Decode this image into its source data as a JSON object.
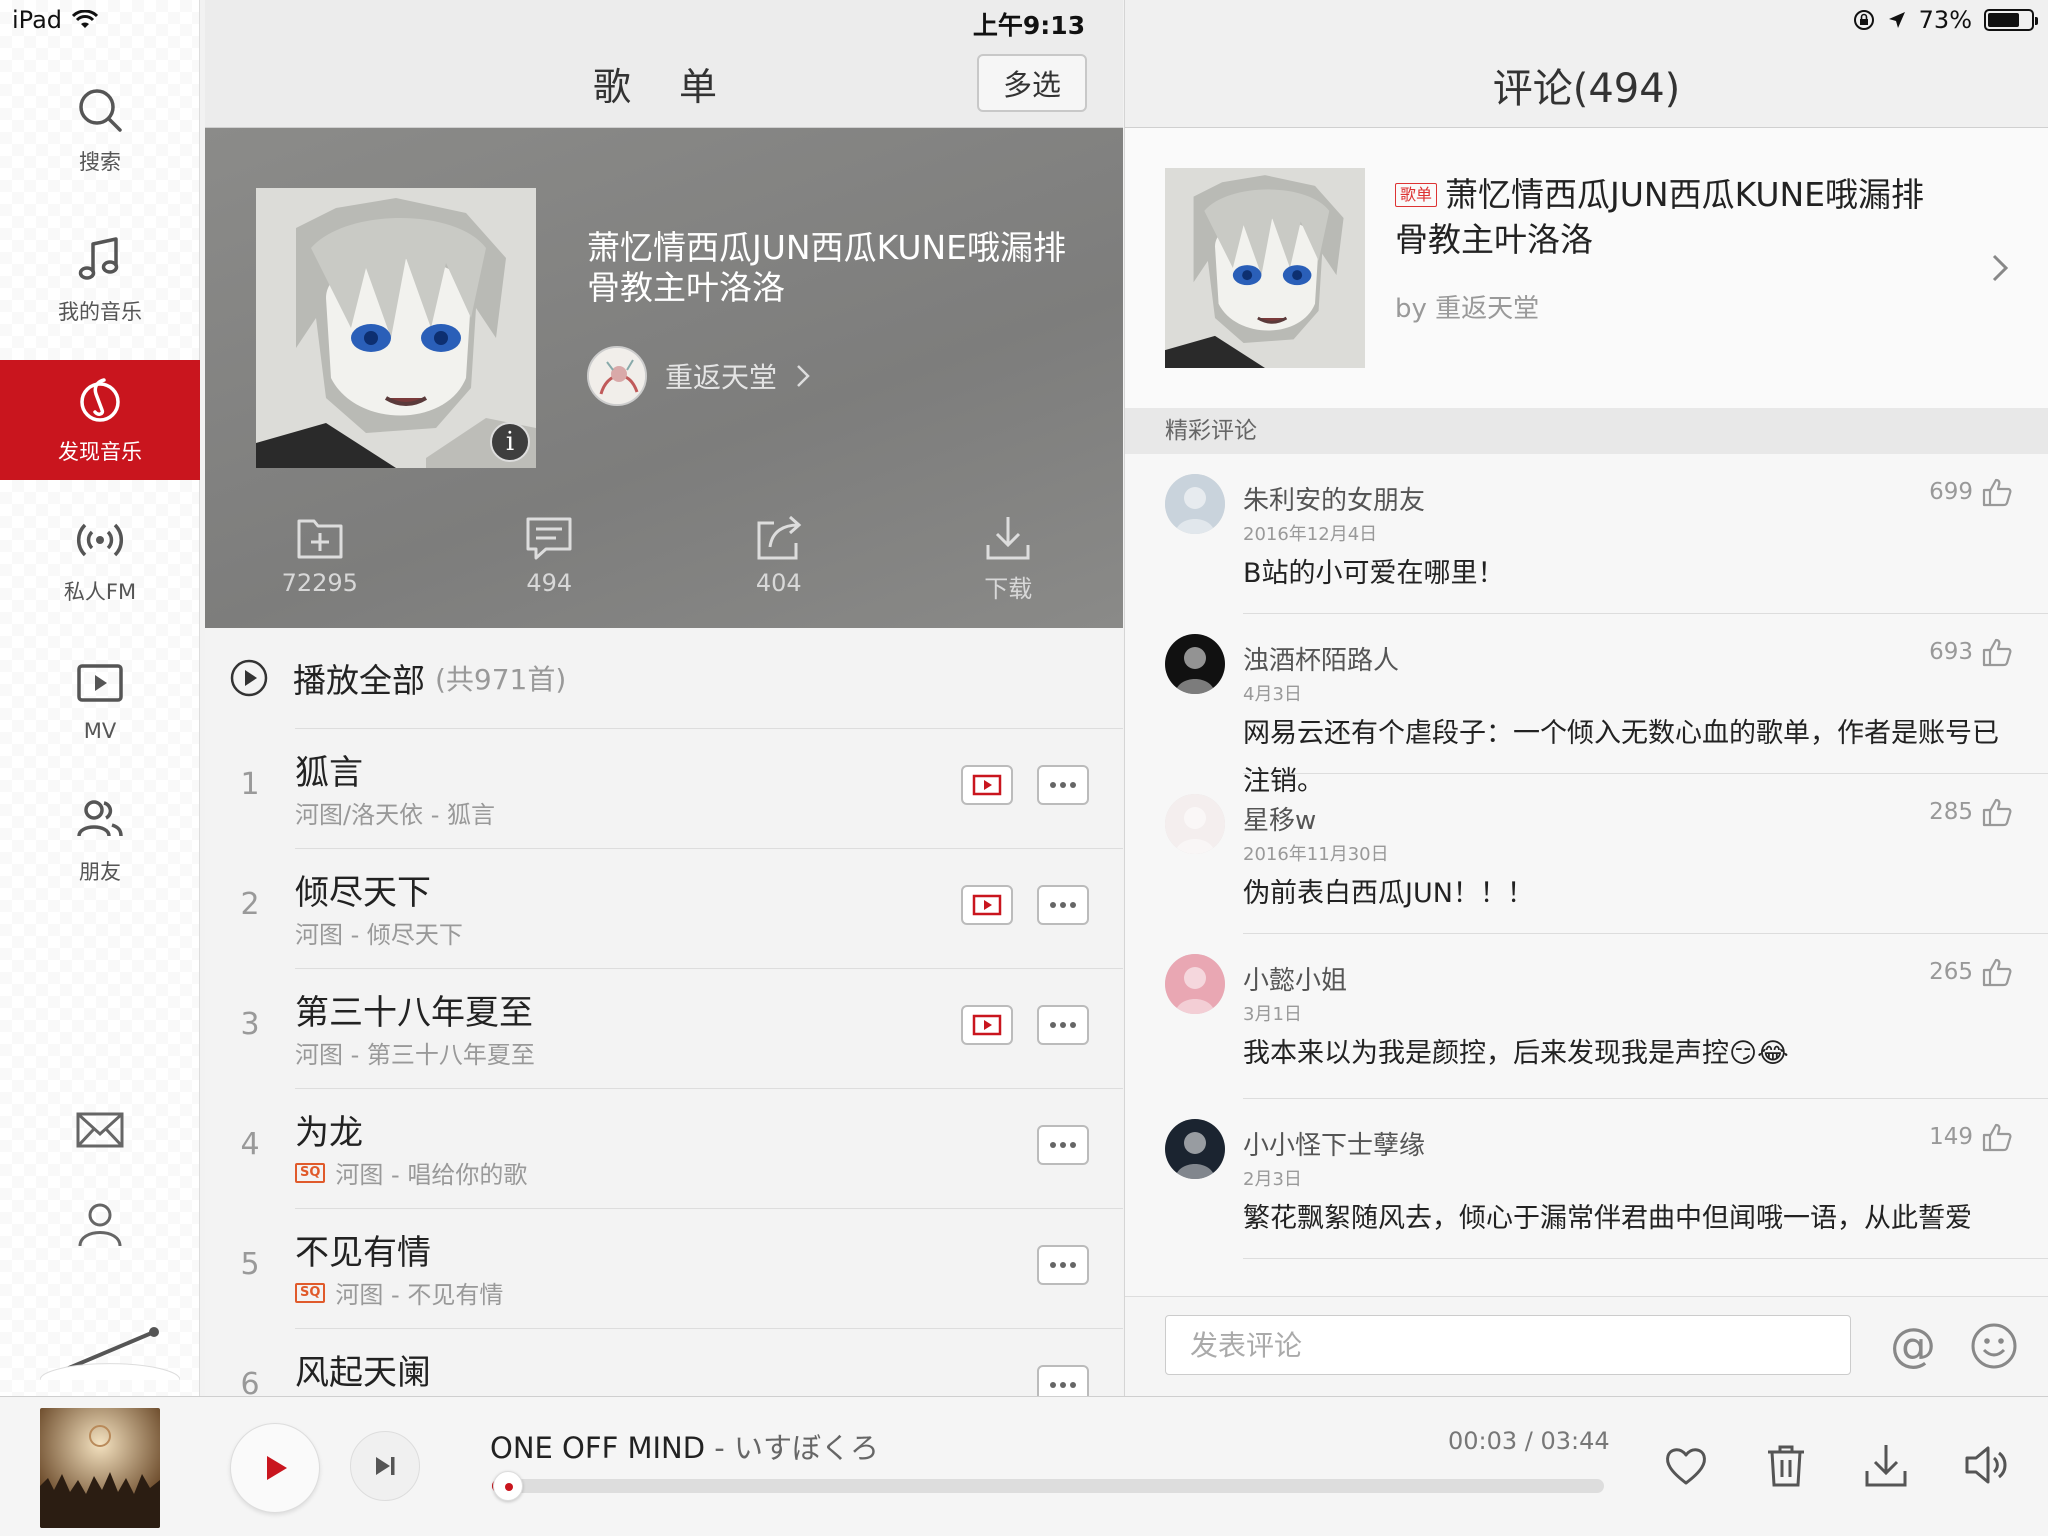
{
  "status": {
    "device": "iPad",
    "time": "上午9:13",
    "battery": "73%"
  },
  "sidebar": {
    "items": [
      {
        "label": "搜索",
        "icon": "search-icon"
      },
      {
        "label": "我的音乐",
        "icon": "music-note-icon"
      },
      {
        "label": "发现音乐",
        "icon": "netease-logo-icon",
        "active": true
      },
      {
        "label": "私人FM",
        "icon": "radio-broadcast-icon"
      },
      {
        "label": "MV",
        "icon": "video-icon"
      },
      {
        "label": "朋友",
        "icon": "friends-icon"
      }
    ],
    "bottom_icons": [
      "mail-icon",
      "user-icon",
      "turntable-needle-icon"
    ]
  },
  "playlist": {
    "header_title": "歌 单",
    "multiselect_label": "多选",
    "title": "萧忆情西瓜JUN西瓜KUNE哦漏排骨教主叶洛洛",
    "creator": "重返天堂",
    "actions": [
      {
        "icon": "add-to-folder-icon",
        "label": "72295"
      },
      {
        "icon": "comment-icon",
        "label": "494"
      },
      {
        "icon": "share-icon",
        "label": "404"
      },
      {
        "icon": "download-icon",
        "label": "下载"
      }
    ],
    "play_all_label": "播放全部",
    "play_all_count": "(共971首)",
    "songs": [
      {
        "num": "1",
        "title": "狐言",
        "sub": "河图/洛天依 - 狐言",
        "sq": false,
        "mv": true
      },
      {
        "num": "2",
        "title": "倾尽天下",
        "sub": "河图 - 倾尽天下",
        "sq": false,
        "mv": true
      },
      {
        "num": "3",
        "title": "第三十八年夏至",
        "sub": "河图 - 第三十八年夏至",
        "sq": false,
        "mv": true
      },
      {
        "num": "4",
        "title": "为龙",
        "sub": "河图 - 唱给你的歌",
        "sq": true,
        "mv": false
      },
      {
        "num": "5",
        "title": "不见有情",
        "sub": "河图 - 不见有情",
        "sq": true,
        "mv": false
      },
      {
        "num": "6",
        "title": "风起天阑",
        "sub": "",
        "sq": false,
        "mv": false
      }
    ],
    "sq_badge": "SQ"
  },
  "comments": {
    "title": "评论(494)",
    "card_tag": "歌单",
    "card_title": "萧忆情西瓜JUN西瓜KUNE哦漏排骨教主叶洛洛",
    "card_by": "by 重返天堂",
    "section_label": "精彩评论",
    "items": [
      {
        "user": "朱利安的女朋友",
        "date": "2016年12月4日",
        "likes": "699",
        "text": "B站的小可爱在哪里！",
        "avatar": "#c9d3dc"
      },
      {
        "user": "浊酒杯陌路人",
        "date": "4月3日",
        "likes": "693",
        "text": "网易云还有个虐段子：一个倾入无数心血的歌单，作者是账号已注销。",
        "avatar": "#111111"
      },
      {
        "user": "星移w",
        "date": "2016年11月30日",
        "likes": "285",
        "text": "伪前表白西瓜JUN！！！",
        "avatar": "#f4eeee"
      },
      {
        "user": "小懿小姐",
        "date": "3月1日",
        "likes": "265",
        "text": "我本来以为我是颜控，后来发现我是声控😏😂",
        "avatar": "#e9a7b3"
      },
      {
        "user": "小小怪下士孽缘",
        "date": "2月3日",
        "likes": "149",
        "text": "繁花飘絮随风去，倾心于漏常伴君曲中但闻哦一语，从此誓爱",
        "avatar": "#1b2430"
      }
    ],
    "input_placeholder": "发表评论",
    "at_symbol": "@"
  },
  "player": {
    "track": "ONE OFF MIND",
    "separator": " - ",
    "artist": "いすぼくろ",
    "elapsed": "00:03",
    "duration": "03:44",
    "time_separator": " / ",
    "progress": 0.014
  },
  "colors": {
    "accent": "#c9151e",
    "sq": "#e05a2b"
  }
}
